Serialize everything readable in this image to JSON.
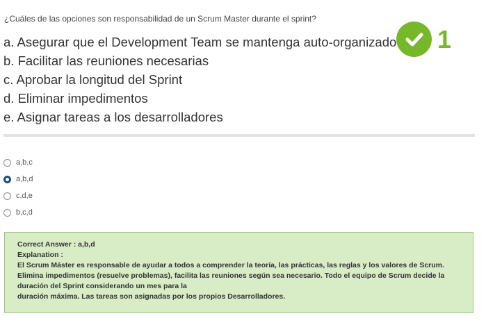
{
  "question": "¿Cuáles de las opciones son responsabilidad de un Scrum Master durante el sprint?",
  "statements": [
    "a. Asegurar que el Development Team se mantenga auto-organizado",
    "b. Facilitar las reuniones necesarias",
    "c. Aprobar la longitud del Sprint",
    "d. Eliminar impedimentos",
    "e. Asignar tareas a los desarrolladores"
  ],
  "badge": {
    "icon": "check-icon",
    "number": "1",
    "color": "#76b82a"
  },
  "choices": [
    {
      "label": "a,b,c",
      "selected": false
    },
    {
      "label": "a,b,d",
      "selected": true
    },
    {
      "label": "c,d,e",
      "selected": false
    },
    {
      "label": "b,c,d",
      "selected": false
    }
  ],
  "answer": {
    "correct": "Correct Answer : a,b,d",
    "explanation_label": "Explanation :",
    "line1": "El Scrum Máster es responsable de ayudar a todos a comprender la teoría, las prácticas, las reglas y los valores de Scrum.",
    "line2": "Elimina impedimentos (resuelve problemas), facilita las reuniones según sea necesario. Todo el equipo de Scrum decide la duración del Sprint considerando un mes para la",
    "line3": "duración máxima. Las tareas son asignadas por los propios Desarrolladores."
  }
}
